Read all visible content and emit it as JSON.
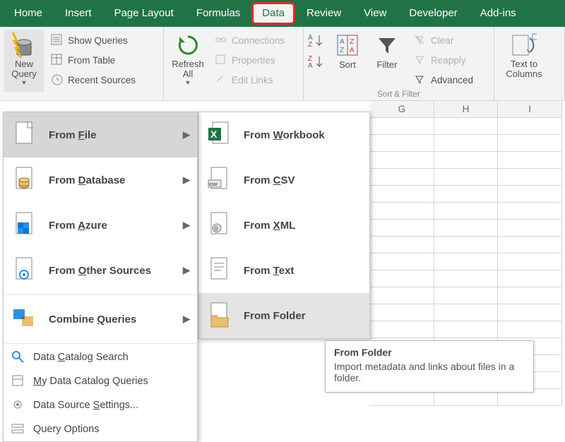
{
  "tabs": [
    "Home",
    "Insert",
    "Page Layout",
    "Formulas",
    "Data",
    "Review",
    "View",
    "Developer",
    "Add-ins"
  ],
  "active_tab_index": 4,
  "ribbon": {
    "new_query": "New Query",
    "refresh_all": "Refresh All",
    "sort": "Sort",
    "filter": "Filter",
    "text_to_columns": "Text to Columns",
    "show_queries": "Show Queries",
    "from_table": "From Table",
    "recent_sources": "Recent Sources",
    "connections": "Connections",
    "properties": "Properties",
    "edit_links": "Edit Links",
    "clear": "Clear",
    "reapply": "Reapply",
    "advanced": "Advanced",
    "group_sort_filter": "Sort & Filter"
  },
  "menu1": [
    {
      "label": "From File",
      "key": "F",
      "sub": true,
      "selected": true,
      "icon": "file"
    },
    {
      "label": "From Database",
      "key": "D",
      "sub": true,
      "icon": "db"
    },
    {
      "label": "From Azure",
      "key": "A",
      "sub": true,
      "icon": "azure"
    },
    {
      "label": "From Other Sources",
      "key": "O",
      "sub": true,
      "icon": "other"
    },
    {
      "label": "Combine Queries",
      "key": "Q",
      "sub": true,
      "icon": "combine"
    }
  ],
  "menu1_small": [
    {
      "label": "Data Catalog Search",
      "key": "C",
      "icon": "search"
    },
    {
      "label": "My Data Catalog Queries",
      "key": "M",
      "icon": "catalog"
    },
    {
      "label": "Data Source Settings...",
      "key": "S",
      "icon": "gear"
    },
    {
      "label": "Query Options",
      "key": "",
      "icon": "options"
    }
  ],
  "menu2": [
    {
      "label": "From Workbook",
      "key": "W",
      "icon": "xlsx"
    },
    {
      "label": "From CSV",
      "key": "C",
      "icon": "csv"
    },
    {
      "label": "From XML",
      "key": "X",
      "icon": "xml"
    },
    {
      "label": "From Text",
      "key": "T",
      "icon": "txt"
    },
    {
      "label": "From Folder",
      "key": "",
      "icon": "folder",
      "hover": true
    }
  ],
  "columns": [
    "G",
    "H",
    "I"
  ],
  "tooltip": {
    "title": "From Folder",
    "body": "Import metadata and links about files in a folder."
  }
}
